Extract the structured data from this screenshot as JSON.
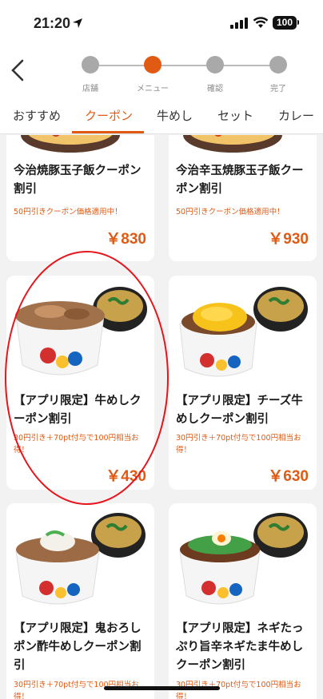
{
  "status_bar": {
    "time": "21:20",
    "battery": "100"
  },
  "steps": [
    {
      "label": "店舗",
      "active": false
    },
    {
      "label": "メニュー",
      "active": true
    },
    {
      "label": "確認",
      "active": false
    },
    {
      "label": "完了",
      "active": false
    }
  ],
  "tabs": [
    {
      "label": "おすすめ",
      "active": false
    },
    {
      "label": "クーポン",
      "active": true
    },
    {
      "label": "牛めし",
      "active": false
    },
    {
      "label": "セット",
      "active": false
    },
    {
      "label": "カレー",
      "active": false
    }
  ],
  "cards": [
    {
      "title": "今治焼豚玉子飯クーポン割引",
      "note": "50円引きクーポン価格適用中！",
      "price": "￥830"
    },
    {
      "title": "今治辛玉焼豚玉子飯クーポン割引",
      "note": "50円引きクーポン価格適用中！",
      "price": "￥930"
    },
    {
      "title": "【アプリ限定】牛めしクーポン割引",
      "note": "30円引き＋70pt付与で100円相当お得！",
      "price": "￥430"
    },
    {
      "title": "【アプリ限定】チーズ牛めしクーポン割引",
      "note": "30円引き＋70pt付与で100円相当お得！",
      "price": "￥630"
    },
    {
      "title": "【アプリ限定】鬼おろしポン酢牛めしクーポン割引",
      "note": "30円引き＋70pt付与で100円相当お得！",
      "price": ""
    },
    {
      "title": "【アプリ限定】ネギたっぷり旨辛ネギたま牛めしクーポン割引",
      "note": "30円引き＋70pt付与で100円相当お得！",
      "price": ""
    }
  ],
  "colors": {
    "accent": "#e05a14",
    "highlight": "#e8141b"
  }
}
